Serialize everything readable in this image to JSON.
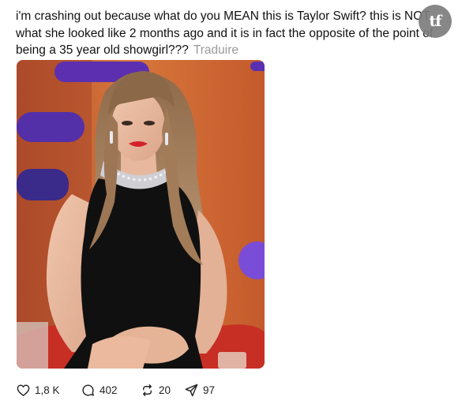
{
  "post": {
    "text": "i'm crashing out because what do you MEAN this is Taylor Swift? this is NOT what she looked like 2 months ago and it is in fact the opposite of the point of being a 35 year old showgirl???",
    "translate_label": "Traduire"
  },
  "watermark": {
    "text": "tf"
  },
  "actions": {
    "likes": "1,8 K",
    "comments": "402",
    "reposts": "20",
    "shares": "97"
  },
  "colors": {
    "text": "#111111",
    "muted": "#9a9a9a",
    "studio_orange": "#c9622e",
    "studio_purple": "#5b2fb0",
    "dress": "#101010"
  },
  "icons": [
    "heart-icon",
    "comment-icon",
    "repost-icon",
    "share-icon"
  ]
}
